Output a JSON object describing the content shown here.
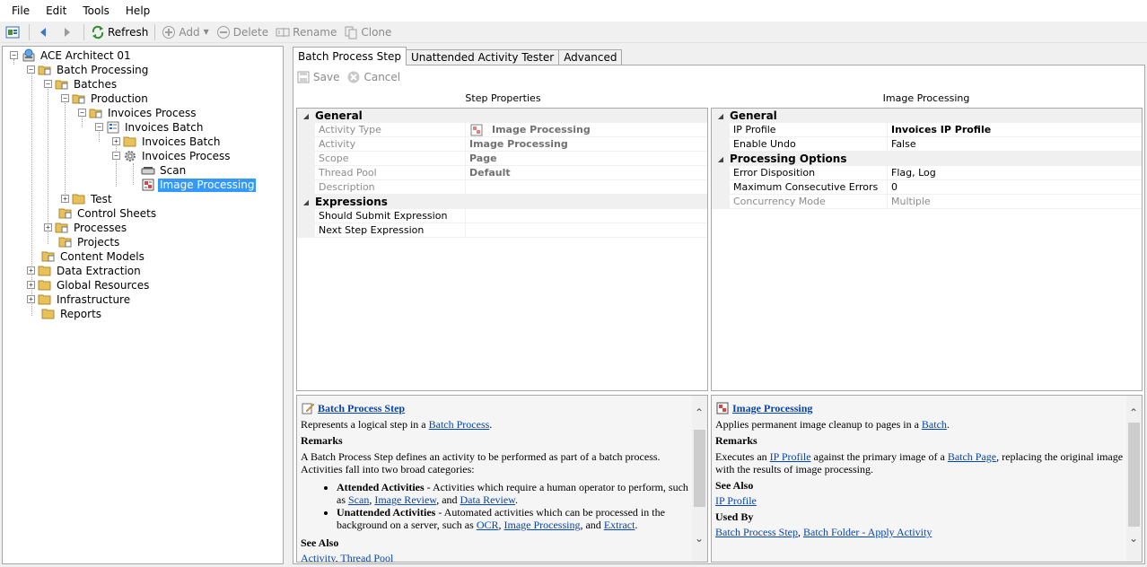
{
  "menu": [
    "File",
    "Edit",
    "Tools",
    "Help"
  ],
  "toolbar": {
    "refresh": "Refresh",
    "add": "Add",
    "delete": "Delete",
    "rename": "Rename",
    "clone": "Clone"
  },
  "tree": {
    "root": "ACE Architect 01",
    "batch_processing": "Batch Processing",
    "batches": "Batches",
    "production": "Production",
    "invoices_process_folder": "Invoices Process",
    "invoices_batch": "Invoices Batch",
    "invoices_batch_child": "Invoices Batch",
    "invoices_process_child": "Invoices Process",
    "scan": "Scan",
    "image_processing": "Image Processing",
    "test": "Test",
    "control_sheets": "Control Sheets",
    "processes": "Processes",
    "projects": "Projects",
    "content_models": "Content Models",
    "data_extraction": "Data Extraction",
    "global_resources": "Global Resources",
    "infrastructure": "Infrastructure",
    "reports": "Reports"
  },
  "tabs": [
    "Batch Process Step",
    "Unattended Activity Tester",
    "Advanced"
  ],
  "editbar": {
    "save": "Save",
    "cancel": "Cancel"
  },
  "step_properties": {
    "title": "Step Properties",
    "general": "General",
    "rows": [
      {
        "name": "Activity Type",
        "value": "Image Processing"
      },
      {
        "name": "Activity",
        "value": "Image Processing"
      },
      {
        "name": "Scope",
        "value": "Page"
      },
      {
        "name": "Thread Pool",
        "value": "Default"
      },
      {
        "name": "Description",
        "value": ""
      }
    ],
    "expressions": "Expressions",
    "expr_rows": [
      {
        "name": "Should Submit Expression",
        "value": ""
      },
      {
        "name": "Next Step Expression",
        "value": ""
      }
    ]
  },
  "image_processing": {
    "title": "Image Processing",
    "general": "General",
    "rows": [
      {
        "name": "IP Profile",
        "value": "Invoices IP Profile"
      },
      {
        "name": "Enable Undo",
        "value": "False"
      }
    ],
    "processing_options": "Processing Options",
    "po_rows": [
      {
        "name": "Error Disposition",
        "value": "Flag, Log"
      },
      {
        "name": "Maximum Consecutive Errors",
        "value": "0"
      },
      {
        "name": "Concurrency Mode",
        "value": "Multiple"
      }
    ]
  },
  "help_left": {
    "title": "Batch Process Step",
    "intro_pre": "Represents a logical step in a ",
    "intro_link": "Batch Process",
    "intro_post": ".",
    "remarks": "Remarks",
    "remarks_text": "A Batch Process Step defines an activity to be performed as part of a batch process. Activities fall into two broad categories:",
    "attended_label": "Attended Activities",
    "attended_text": " - Activities which require a human operator to perform, such as ",
    "attended_links": [
      "Scan",
      "Image Review",
      "Data Review"
    ],
    "unattended_label": "Unattended Activities",
    "unattended_text": " - Automated activities which can be processed in the background on a server, such as ",
    "unattended_links": [
      "OCR",
      "Image Processing",
      "Extract"
    ],
    "see_also": "See Also",
    "see_also_links": [
      "Activity",
      "Thread Pool"
    ]
  },
  "help_right": {
    "title": "Image Processing",
    "intro_pre": "Applies permanent image cleanup to pages in a ",
    "intro_link": "Batch",
    "intro_post": ".",
    "remarks": "Remarks",
    "remarks_pre": "Executes an ",
    "remarks_link1": "IP Profile",
    "remarks_mid": " against the primary image of a ",
    "remarks_link2": "Batch Page",
    "remarks_post": ", replacing the original image with the results of image processing.",
    "see_also": "See Also",
    "see_also_link": "IP Profile",
    "used_by": "Used By",
    "used_by_links": [
      "Batch Process Step",
      "Batch Folder - Apply Activity"
    ]
  }
}
